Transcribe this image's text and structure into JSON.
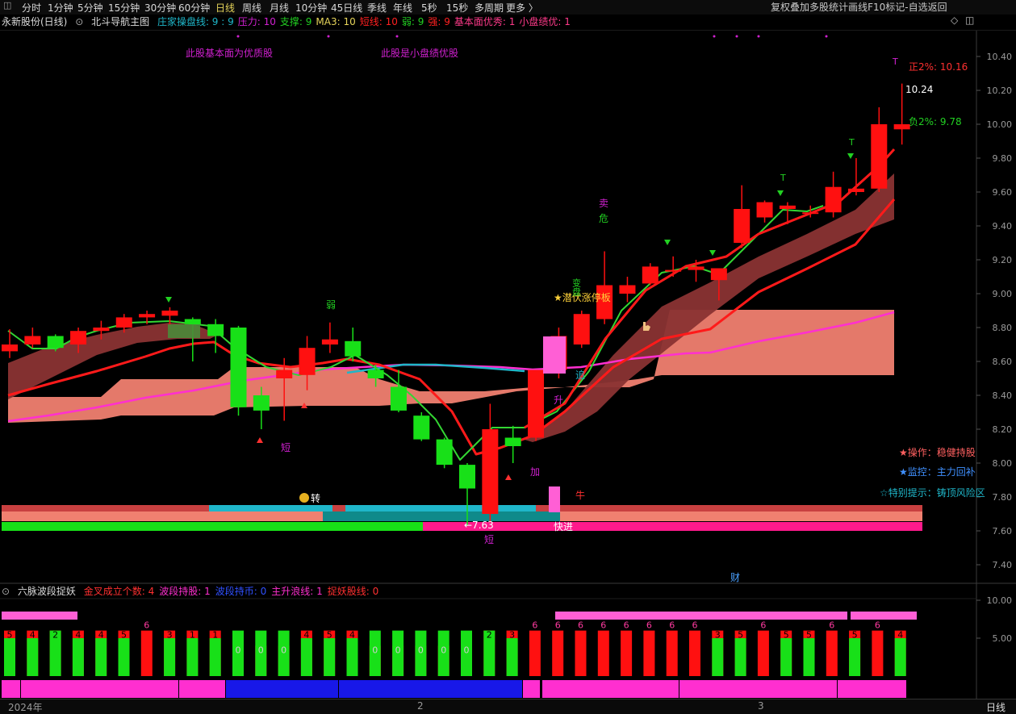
{
  "toolbar": {
    "periods": [
      "分时",
      "1分钟",
      "5分钟",
      "15分钟",
      "30分钟",
      "60分钟",
      "日线",
      "周线",
      "月线",
      "10分钟",
      "45日线",
      "季线",
      "年线",
      "5秒",
      "15秒",
      "多周期",
      "更多 〉"
    ],
    "active_period": "日线",
    "right_buttons": [
      "复权",
      "叠加",
      "多股",
      "统计",
      "画线",
      "F10",
      "标记",
      "-自选",
      "返回"
    ]
  },
  "info": {
    "stock_title": "永新股份(日线)",
    "indicator_name": "北斗导航主图",
    "items": [
      {
        "text": "庄家操盘线: 9 : 9",
        "color": "#1fb6c9"
      },
      {
        "text": "压力: 10",
        "color": "#d020d0"
      },
      {
        "text": "支撑: 9",
        "color": "#22d022"
      },
      {
        "text": "MA3: 10",
        "color": "#e6d45a"
      },
      {
        "text": "短线: 10",
        "color": "#ff2020"
      },
      {
        "text": "弱: 9",
        "color": "#22d022"
      },
      {
        "text": "强: 9",
        "color": "#ff2020"
      },
      {
        "text": "基本面优秀: 1",
        "color": "#ff3a8a"
      },
      {
        "text": "小盘绩优: 1",
        "color": "#ff3a8a"
      }
    ]
  },
  "annotations": {
    "fundamental_quality": "此股基本面为优质股",
    "small_cap_quality": "此股是小盘绩优股",
    "upper_band": "正2%: 10.16",
    "lower_band": "负2%: 9.78",
    "last_price": "10.24",
    "low_price": "7.63",
    "quick_entry": "快进",
    "operation": "★操作：稳健持股",
    "monitor": "★监控：主力回补",
    "special_tip": "☆特别提示：铸顶风险区",
    "hidden_limit_up": "★潜伏涨停板",
    "money_turn": "转",
    "fin_marker": "财",
    "signals": {
      "sell": "卖",
      "danger": "危",
      "weak": "弱",
      "short": "短",
      "add": "加",
      "rise": "升",
      "chase": "追",
      "cow": "牛",
      "t": "T",
      "vertical_tag": "变盘"
    }
  },
  "main_axis": {
    "ticks": [
      "10.40",
      "10.20",
      "10.00",
      "9.80",
      "9.60",
      "9.40",
      "9.20",
      "9.00",
      "8.80",
      "8.60",
      "8.40",
      "8.20",
      "8.00",
      "7.80",
      "7.60",
      "7.40"
    ]
  },
  "sub_panel": {
    "title": "六脉波段捉妖",
    "items": [
      {
        "text": "金叉成立个数: 4",
        "color": "#ff3030"
      },
      {
        "text": "波段持股: 1",
        "color": "#ff2fd0"
      },
      {
        "text": "波段持币: 0",
        "color": "#3050ff"
      },
      {
        "text": "主升浪线: 1",
        "color": "#ff2fd0"
      },
      {
        "text": "捉妖股线: 0",
        "color": "#ff3030"
      }
    ],
    "axis_ticks": [
      "10.00",
      "5.00"
    ],
    "bar_numbers": [
      "5",
      "4",
      "2",
      "4",
      "4",
      "5",
      "6",
      "3",
      "1",
      "1",
      "0",
      "0",
      "0",
      "4",
      "5",
      "4",
      "0",
      "0",
      "0",
      "0",
      "0",
      "2",
      "3",
      "6",
      "6",
      "6",
      "6",
      "6",
      "6",
      "6",
      "6",
      "3",
      "5",
      "6",
      "5",
      "5",
      "6",
      "5",
      "6",
      "4"
    ]
  },
  "date_axis": {
    "labels": [
      "2024年",
      "2",
      "3"
    ],
    "period_label": "日线"
  },
  "colors": {
    "up": "#ff1010",
    "down": "#18e018",
    "pink": "#ff5fd5",
    "magenta": "#ff2fd0",
    "band_dark": "#8a3333",
    "band_light": "#f08070",
    "cyan": "#1fb6c9",
    "blue": "#1818e8"
  },
  "chart_data": {
    "type": "candlestick",
    "ylim": [
      7.3,
      10.5
    ],
    "candles": [
      {
        "o": 8.66,
        "h": 8.79,
        "l": 8.62,
        "c": 8.7
      },
      {
        "o": 8.7,
        "h": 8.8,
        "l": 8.68,
        "c": 8.75
      },
      {
        "o": 8.75,
        "h": 8.76,
        "l": 8.66,
        "c": 8.68
      },
      {
        "o": 8.7,
        "h": 8.8,
        "l": 8.65,
        "c": 8.78
      },
      {
        "o": 8.78,
        "h": 8.84,
        "l": 8.73,
        "c": 8.8
      },
      {
        "o": 8.8,
        "h": 8.88,
        "l": 8.77,
        "c": 8.86
      },
      {
        "o": 8.86,
        "h": 8.9,
        "l": 8.82,
        "c": 8.88
      },
      {
        "o": 8.87,
        "h": 8.92,
        "l": 8.81,
        "c": 8.9
      },
      {
        "o": 8.85,
        "h": 8.86,
        "l": 8.6,
        "c": 8.82
      },
      {
        "o": 8.82,
        "h": 8.85,
        "l": 8.65,
        "c": 8.75
      },
      {
        "o": 8.8,
        "h": 8.81,
        "l": 8.28,
        "c": 8.33
      },
      {
        "o": 8.4,
        "h": 8.45,
        "l": 8.2,
        "c": 8.31
      },
      {
        "o": 8.5,
        "h": 8.62,
        "l": 8.25,
        "c": 8.55
      },
      {
        "o": 8.52,
        "h": 8.75,
        "l": 8.43,
        "c": 8.68
      },
      {
        "o": 8.7,
        "h": 8.83,
        "l": 8.65,
        "c": 8.73
      },
      {
        "o": 8.72,
        "h": 8.8,
        "l": 8.6,
        "c": 8.63
      },
      {
        "o": 8.55,
        "h": 8.58,
        "l": 8.45,
        "c": 8.5
      },
      {
        "o": 8.45,
        "h": 8.55,
        "l": 8.3,
        "c": 8.31
      },
      {
        "o": 8.28,
        "h": 8.3,
        "l": 8.13,
        "c": 8.14
      },
      {
        "o": 8.14,
        "h": 8.15,
        "l": 7.97,
        "c": 7.99
      },
      {
        "o": 7.99,
        "h": 8.0,
        "l": 7.63,
        "c": 7.85
      },
      {
        "o": 7.7,
        "h": 8.35,
        "l": 7.65,
        "c": 8.2
      },
      {
        "o": 8.15,
        "h": 8.22,
        "l": 8.0,
        "c": 8.1
      },
      {
        "o": 8.15,
        "h": 8.5,
        "l": 8.13,
        "c": 8.55
      },
      {
        "o": 8.55,
        "h": 8.8,
        "l": 8.5,
        "c": 8.75
      },
      {
        "o": 8.7,
        "h": 8.9,
        "l": 8.68,
        "c": 8.88
      },
      {
        "o": 8.85,
        "h": 9.25,
        "l": 8.82,
        "c": 9.05
      },
      {
        "o": 9.0,
        "h": 9.1,
        "l": 8.95,
        "c": 9.05
      },
      {
        "o": 9.06,
        "h": 9.18,
        "l": 9.05,
        "c": 9.16
      },
      {
        "o": 9.13,
        "h": 9.22,
        "l": 9.1,
        "c": 9.14
      },
      {
        "o": 9.14,
        "h": 9.2,
        "l": 9.07,
        "c": 9.16
      },
      {
        "o": 9.08,
        "h": 9.15,
        "l": 8.96,
        "c": 9.15
      },
      {
        "o": 9.3,
        "h": 9.64,
        "l": 9.27,
        "c": 9.5
      },
      {
        "o": 9.45,
        "h": 9.55,
        "l": 9.42,
        "c": 9.54
      },
      {
        "o": 9.5,
        "h": 9.54,
        "l": 9.41,
        "c": 9.52
      },
      {
        "o": 9.48,
        "h": 9.52,
        "l": 9.45,
        "c": 9.48
      },
      {
        "o": 9.48,
        "h": 9.72,
        "l": 9.45,
        "c": 9.63
      },
      {
        "o": 9.6,
        "h": 9.8,
        "l": 9.58,
        "c": 9.62
      },
      {
        "o": 9.62,
        "h": 10.1,
        "l": 9.6,
        "c": 10.0
      },
      {
        "o": 9.97,
        "h": 10.24,
        "l": 9.88,
        "c": 10.0
      }
    ],
    "sub_bars_red": [
      6,
      6,
      6,
      6,
      6,
      6,
      6,
      6,
      6,
      6,
      4,
      4,
      4,
      6,
      6,
      6,
      4,
      4,
      4,
      4,
      4,
      6,
      6,
      6,
      6,
      6,
      6,
      6,
      6,
      6,
      6,
      6,
      6,
      6,
      6,
      6,
      6,
      6,
      6,
      6
    ],
    "sub_bars_green": [
      1,
      1,
      2,
      1,
      1,
      1,
      0,
      1,
      1,
      1,
      6,
      6,
      6,
      1,
      1,
      1,
      6,
      6,
      6,
      6,
      6,
      2,
      1,
      0,
      0,
      0,
      0,
      0,
      0,
      0,
      0,
      1,
      1,
      0,
      1,
      1,
      0,
      1,
      0,
      1
    ]
  }
}
